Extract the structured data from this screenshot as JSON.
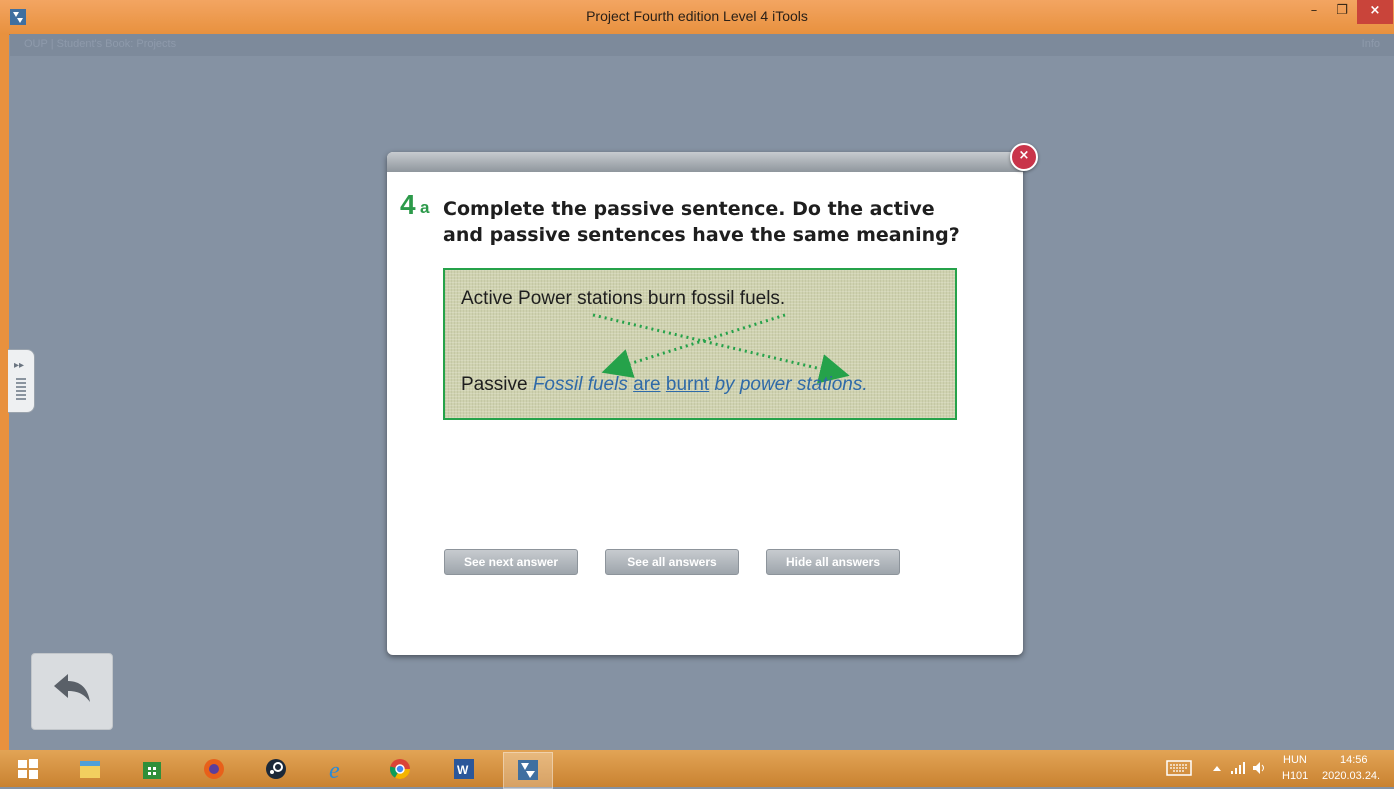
{
  "window": {
    "title": "Project Fourth edition Level 4 iTools",
    "minimize": "–",
    "maximize": "❐",
    "close": "×"
  },
  "breadcrumb": {
    "path": "OUP  |  Student's Book: Projects",
    "info": "Info"
  },
  "dialog": {
    "close_icon": "×",
    "question_number": "4",
    "question_letter": "a",
    "question_text_line1": "Complete the passive sentence. Do the active",
    "question_text_line2": "and passive sentences have the same meaning?",
    "active_label": "Active",
    "active_sentence": "Power stations burn fossil fuels.",
    "passive_label": "Passive",
    "passive_part1": "Fossil fuels",
    "answer1": "are",
    "answer2": "burnt",
    "passive_part2": "by power stations.",
    "buttons": {
      "see_next": "See next answer",
      "see_all": "See all answers",
      "hide_all": "Hide all answers"
    },
    "accent_color": "#25a24a",
    "answer_color": "#2f6aa8"
  },
  "taskbar": {
    "items": [
      "start-icon",
      "file-explorer-icon",
      "store-icon",
      "firefox-icon",
      "steam-icon",
      "internet-explorer-icon",
      "chrome-icon",
      "word-icon",
      "itools-icon"
    ],
    "language": "HUN",
    "keyboard_layout": "H101",
    "time": "14:56",
    "date": "2020.03.24."
  }
}
